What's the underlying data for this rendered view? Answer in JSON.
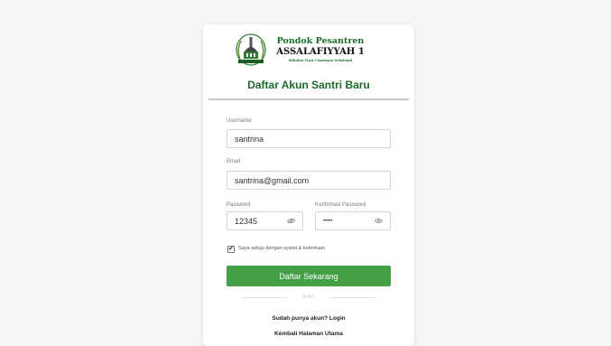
{
  "logo": {
    "line1": "Pondok Pesantren",
    "line2": "ASSALAFIYYAH 1",
    "line3": "Bekalan Tiyar Cinatayan Sekaloani"
  },
  "form": {
    "title": "Daftar Akun Santri Baru",
    "username": {
      "label": "Username",
      "value": "santrina"
    },
    "email": {
      "label": "Email",
      "value": "santrina@gmail.com"
    },
    "password": {
      "label": "Password",
      "value": "12345"
    },
    "confirm_password": {
      "label": "Konfirmasi Password",
      "value": "•••••"
    },
    "agree": {
      "label": "Saya setuju dengan syarat & ketentuan",
      "checked": true,
      "mark": "✔"
    },
    "submit_label": "Daftar Sekarang",
    "separator": "ATAU",
    "login_link": "Sudah punya akun? Login",
    "home_link": "Kembali Halaman Utama"
  },
  "colors": {
    "accent": "#43a047",
    "title": "#1d6b2a"
  },
  "icons": [
    "eye-icon",
    "check-icon"
  ]
}
